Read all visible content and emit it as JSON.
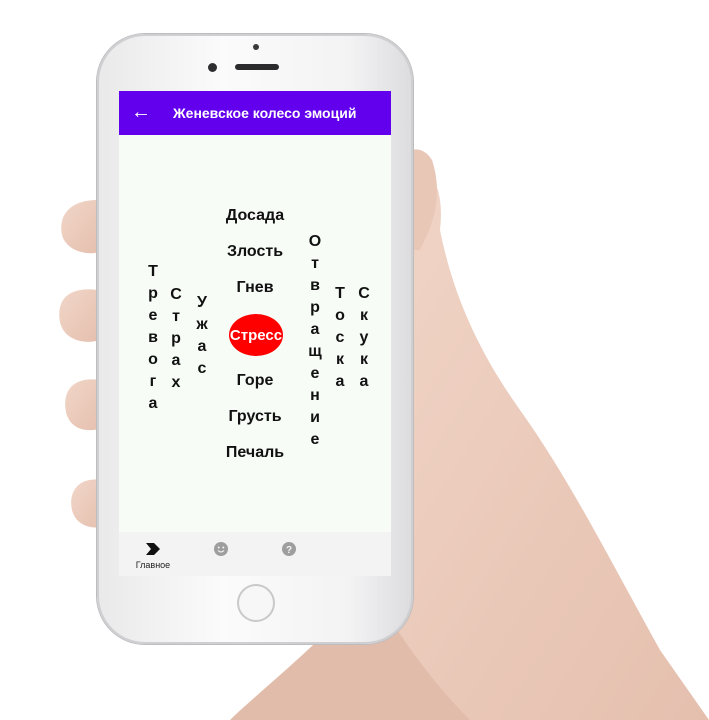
{
  "appbar": {
    "title": "Женевское колесо эмоций",
    "back_icon": "←"
  },
  "wheel": {
    "center": "Стресс",
    "top": [
      "Досада",
      "Злость",
      "Гнев"
    ],
    "bottom": [
      "Горе",
      "Грусть",
      "Печаль"
    ],
    "left": [
      "Тревога",
      "Страх",
      "Ужас"
    ],
    "right": [
      "Отвращение",
      "Тоска",
      "Скука"
    ]
  },
  "bottom_nav": [
    {
      "icon": "forward-arrow-icon",
      "label": "Главное",
      "active": true
    },
    {
      "icon": "smiley-icon",
      "label": "",
      "active": false
    },
    {
      "icon": "help-icon",
      "label": "",
      "active": false
    }
  ],
  "colors": {
    "appbar": "#6200ee",
    "center_bubble": "#ff0000",
    "screen_bg": "#f7fcf7"
  }
}
